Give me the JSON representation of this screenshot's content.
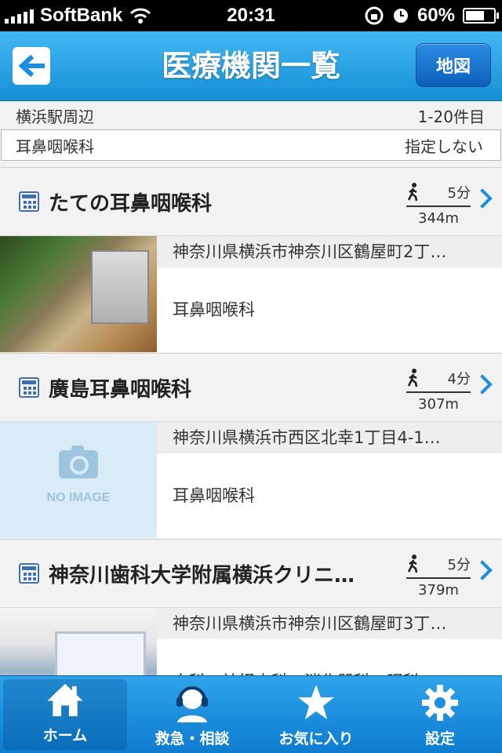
{
  "status_bar": {
    "carrier": "SoftBank",
    "time": "20:31",
    "battery": "60%"
  },
  "header": {
    "title": "医療機関一覧",
    "map_button": "地図"
  },
  "summary": {
    "area": "横浜駅周辺",
    "range": "1-20件目"
  },
  "filter": {
    "department": "耳鼻咽喉科",
    "option": "指定しない"
  },
  "facilities": [
    {
      "name": "たての耳鼻咽喉科",
      "walk": "5分",
      "distance": "344m",
      "address": "神奈川県横浜市神奈川区鶴屋町2丁…",
      "departments": "耳鼻咽喉科",
      "thumbnail": "photo"
    },
    {
      "name": "廣島耳鼻咽喉科",
      "walk": "4分",
      "distance": "307m",
      "address": "神奈川県横浜市西区北幸1丁目4-1…",
      "departments": "耳鼻咽喉科",
      "thumbnail": "no-image",
      "no_image_label": "NO IMAGE"
    },
    {
      "name": "神奈川歯科大学附属横浜クリニ…",
      "walk": "5分",
      "distance": "379m",
      "address": "神奈川県横浜市神奈川区鶴屋町3丁…",
      "departments": "内科・神経内科・消化器科・眼科・",
      "thumbnail": "photo"
    }
  ],
  "tabs": [
    {
      "label": "ホーム",
      "icon": "home-icon",
      "active": true
    },
    {
      "label": "救急・相談",
      "icon": "operator-icon",
      "active": false
    },
    {
      "label": "お気に入り",
      "icon": "star-icon",
      "active": false
    },
    {
      "label": "設定",
      "icon": "gear-icon",
      "active": false
    }
  ],
  "colors": {
    "accent": "#1a8ee0",
    "header_top": "#43b7f2",
    "header_bottom": "#1590d6"
  }
}
